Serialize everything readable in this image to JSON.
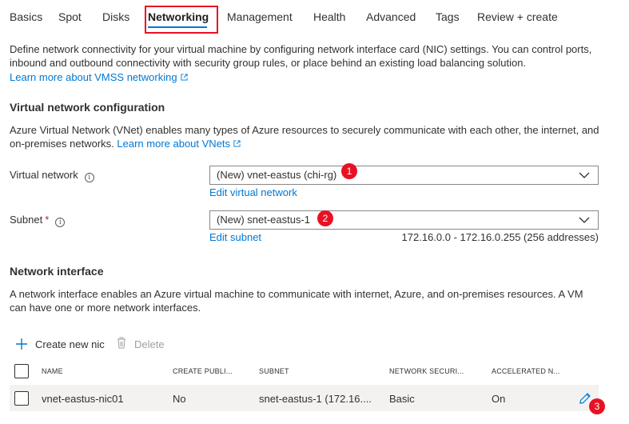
{
  "tabs": [
    {
      "label": "Basics"
    },
    {
      "label": "Spot"
    },
    {
      "label": "Disks"
    },
    {
      "label": "Networking"
    },
    {
      "label": "Management"
    },
    {
      "label": "Health"
    },
    {
      "label": "Advanced"
    },
    {
      "label": "Tags"
    },
    {
      "label": "Review + create"
    }
  ],
  "intro": {
    "line1": "Define network connectivity for your virtual machine by configuring network interface card (NIC) settings. You can control ports,",
    "line2": "inbound and outbound connectivity with security group rules, or place behind an existing load balancing solution.",
    "link": "Learn more about VMSS networking"
  },
  "vnet_section": {
    "heading": "Virtual network configuration",
    "desc_line1": "Azure Virtual Network (VNet) enables many types of Azure resources to securely communicate with each other, the internet, and",
    "desc_line2": "on-premises networks.",
    "desc_link": "Learn more about VNets"
  },
  "virtual_network": {
    "label": "Virtual network",
    "value": "(New) vnet-eastus (chi-rg)",
    "edit_link": "Edit virtual network",
    "badge": "1"
  },
  "subnet": {
    "label": "Subnet",
    "required_mark": "*",
    "value": "(New) snet-eastus-1",
    "edit_link": "Edit subnet",
    "range": "172.16.0.0 - 172.16.0.255 (256 addresses)",
    "badge": "2"
  },
  "nic_section": {
    "heading": "Network interface",
    "desc_line1": "A network interface enables an Azure virtual machine to communicate with internet, Azure, and on-premises resources. A VM",
    "desc_line2": "can have one or more network interfaces."
  },
  "toolbar": {
    "create_label": "Create new nic",
    "delete_label": "Delete"
  },
  "table": {
    "columns": [
      "NAME",
      "CREATE PUBLI...",
      "SUBNET",
      "NETWORK SECURI...",
      "ACCELERATED N..."
    ],
    "rows": [
      {
        "name": "vnet-eastus-nic01",
        "public_ip": "No",
        "subnet": "snet-eastus-1 (172.16....",
        "nsg": "Basic",
        "accelerated": "On"
      }
    ],
    "edit_badge": "3"
  },
  "colors": {
    "accent": "#0078d4",
    "badge": "#e81123",
    "highlight_border": "#e81123",
    "row_bg": "#f3f2f1"
  }
}
